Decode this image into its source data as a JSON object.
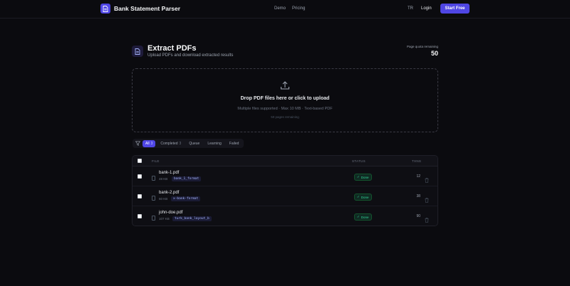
{
  "header": {
    "brand": "Bank Statement Parser",
    "nav": [
      "Demo",
      "Pricing"
    ],
    "lang": "TR",
    "login": "Login",
    "start": "Start Free",
    "accent": "#4f46e5"
  },
  "page": {
    "title": "Extract PDFs",
    "subtitle": "Upload PDFs and download extracted results",
    "quota_label": "Page quota remaining",
    "quota_value": "50"
  },
  "dropzone": {
    "title": "Drop PDF files here or click to upload",
    "sub": "Multiple files supported · Max 10 MB · Text-based PDF",
    "remaining": "50 pages remaining"
  },
  "filters": [
    {
      "label": "All",
      "count": "3",
      "active": true
    },
    {
      "label": "Completed",
      "count": "3",
      "active": false
    },
    {
      "label": "Queue",
      "count": "",
      "active": false
    },
    {
      "label": "Learning",
      "count": "",
      "active": false
    },
    {
      "label": "Failed",
      "count": "",
      "active": false
    }
  ],
  "table": {
    "columns": {
      "file": "FILE",
      "status": "STATUS",
      "txns": "TXNS"
    },
    "rows": [
      {
        "name": "bank-1.pdf",
        "size": "48 KB",
        "format": "bank_1_format",
        "status": "Done",
        "txns": "12"
      },
      {
        "name": "bank-2.pdf",
        "size": "60 KB",
        "format": "x-bank-format",
        "status": "Done",
        "txns": "38"
      },
      {
        "name": "john-doe.pdf",
        "size": "107 KB",
        "format": "turk_bank_layout_b",
        "status": "Done",
        "txns": "90"
      }
    ]
  }
}
